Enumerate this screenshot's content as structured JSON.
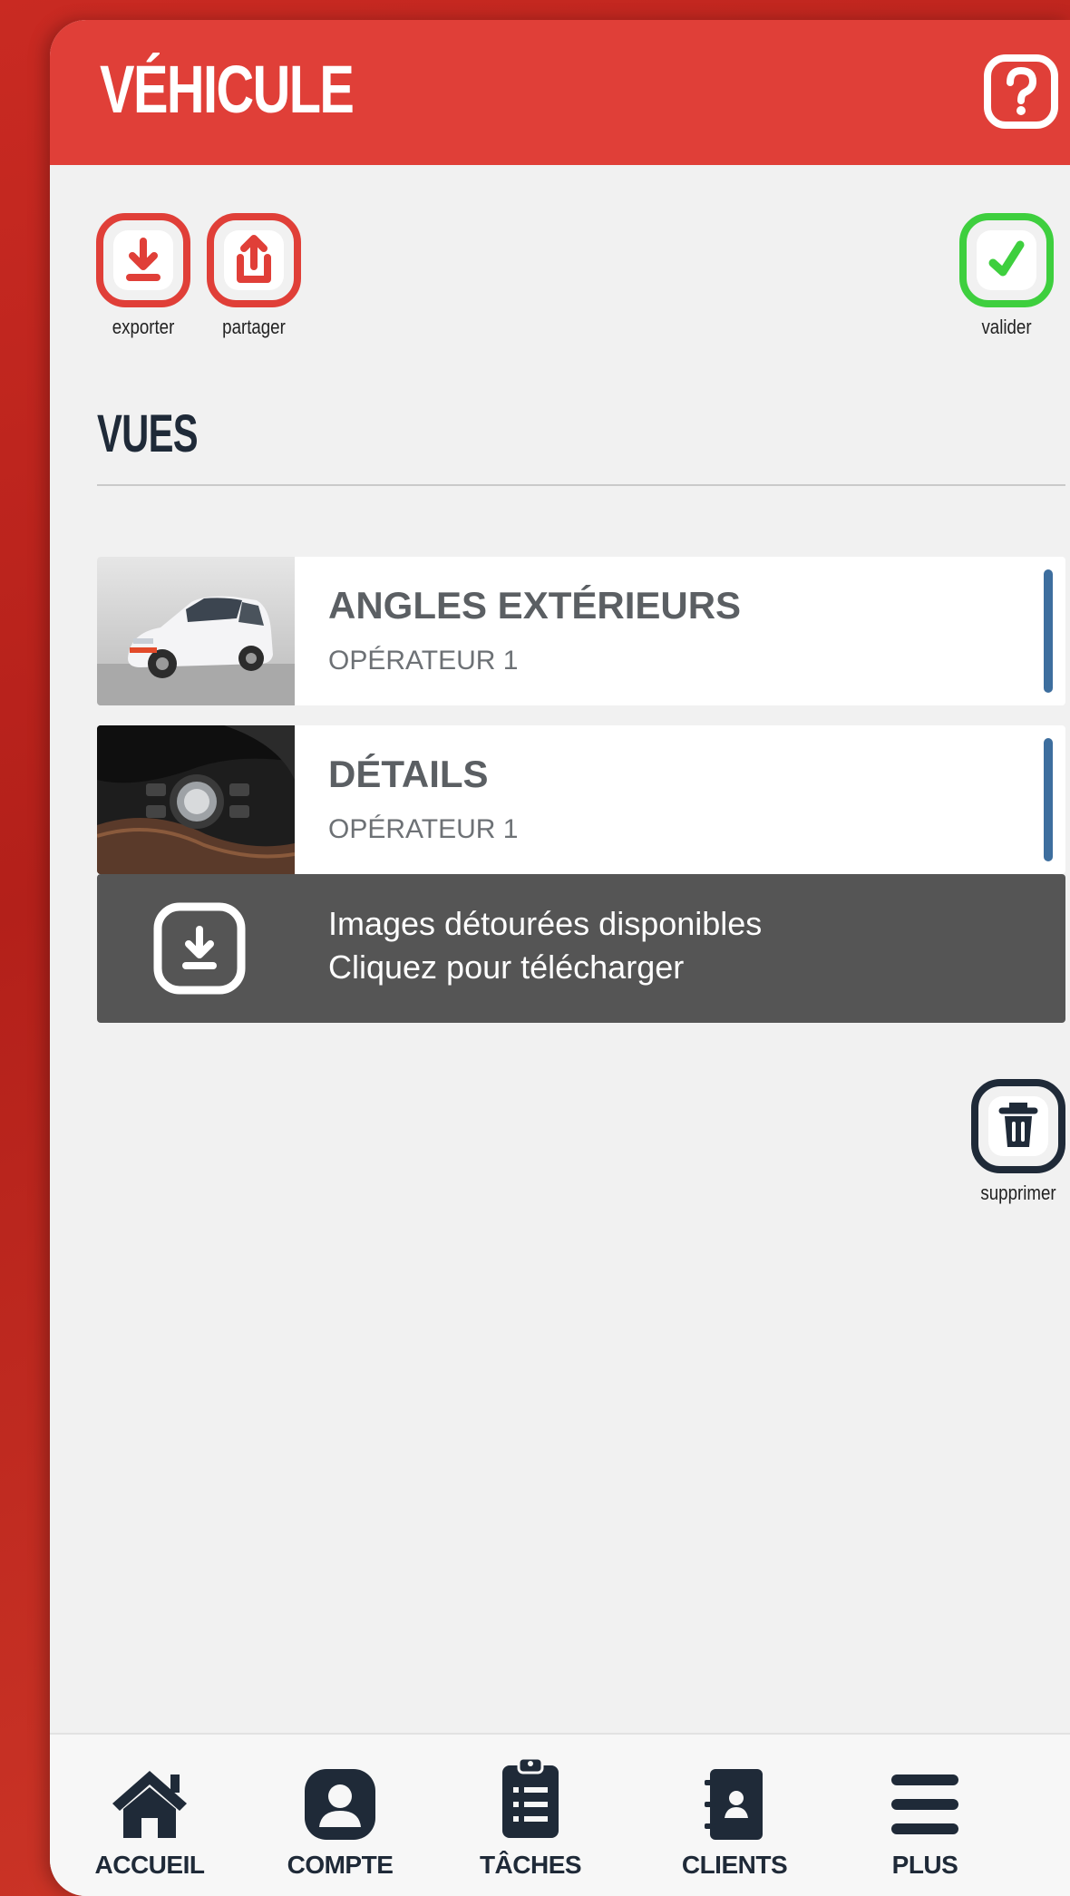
{
  "header": {
    "title": "VÉHICULE",
    "help_icon": "question-mark-icon"
  },
  "toolbar": {
    "export_label": "exporter",
    "share_label": "partager",
    "validate_label": "valider"
  },
  "colors": {
    "brand_red": "#e03f38",
    "validate_green": "#3ecf3e",
    "dark_navy": "#1f2a38",
    "status_blue": "#3d6e9e"
  },
  "views": {
    "title": "VUES",
    "items": [
      {
        "name": "ANGLES EXTÉRIEURS",
        "operator": "OPÉRATEUR 1"
      },
      {
        "name": "DÉTAILS",
        "operator": "OPÉRATEUR 1"
      }
    ]
  },
  "banner": {
    "line1": "Images détourées disponibles",
    "line2": "Cliquez pour télécharger"
  },
  "delete": {
    "label": "supprimer"
  },
  "nav": {
    "items": [
      {
        "label": "ACCUEIL",
        "icon": "home-icon"
      },
      {
        "label": "COMPTE",
        "icon": "user-icon"
      },
      {
        "label": "TÂCHES",
        "icon": "clipboard-list-icon"
      },
      {
        "label": "CLIENTS",
        "icon": "address-book-icon"
      },
      {
        "label": "PLUS",
        "icon": "menu-icon"
      }
    ]
  }
}
